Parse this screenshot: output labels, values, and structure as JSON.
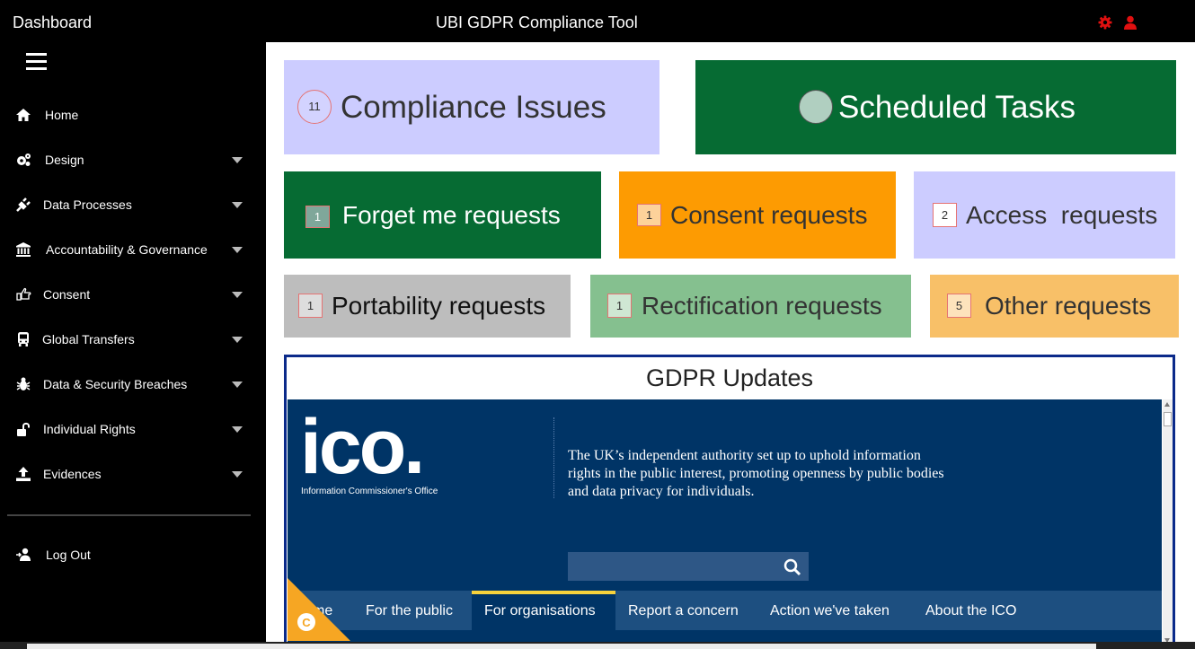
{
  "topbar": {
    "dashboard": "Dashboard",
    "app_title": "UBI GDPR Compliance Tool",
    "icons": [
      "gear-icon",
      "user-icon"
    ],
    "icon_color": "#e01010"
  },
  "sidebar": {
    "items": [
      {
        "label": "Home",
        "icon": "home-icon"
      },
      {
        "label": "Design",
        "icon": "gears-icon"
      },
      {
        "label": "Data Processes",
        "icon": "plug-icon"
      },
      {
        "label": "Accountability & Governance",
        "icon": "bank-icon"
      },
      {
        "label": "Consent",
        "icon": "hand-pointer-icon"
      },
      {
        "label": "Global Transfers",
        "icon": "bus-icon"
      },
      {
        "label": "Data & Security Breaches",
        "icon": "bug-icon"
      },
      {
        "label": "Individual Rights",
        "icon": "unlock-icon"
      },
      {
        "label": "Evidences",
        "icon": "upload-icon"
      }
    ],
    "logout": "Log Out"
  },
  "tiles": {
    "compliance": {
      "label": "Compliance Issues",
      "count": "11",
      "color": "#ccccff"
    },
    "scheduled": {
      "label": "Scheduled Tasks",
      "color": "#066b33"
    },
    "forget": {
      "label": "Forget me requests",
      "count": "1",
      "color": "#066b33"
    },
    "consent": {
      "label": "Consent requests",
      "count": "1",
      "color": "#fd9b02"
    },
    "access": {
      "label": "Access  requests",
      "count": "2",
      "color": "#ccccff"
    },
    "portability": {
      "label": "Portability requests",
      "count": "1",
      "color": "#bdbdbd"
    },
    "rectification": {
      "label": "Rectification requests",
      "count": "1",
      "color": "#85c08f"
    },
    "other": {
      "label": "Other requests",
      "count": "5",
      "color": "#f8c068"
    }
  },
  "updates": {
    "title": "GDPR Updates",
    "ico": {
      "logo": "ico.",
      "logo_sub": "Information Commissioner's Office",
      "tagline": "The UK’s independent authority set up to uphold information rights in the public interest, promoting openness by public bodies and data privacy for individuals.",
      "nav": [
        "me",
        "For the public",
        "For organisations",
        "Report a concern",
        "Action we've taken",
        "About the ICO"
      ],
      "active_nav": "For organisations",
      "cookie_letter": "C"
    }
  }
}
